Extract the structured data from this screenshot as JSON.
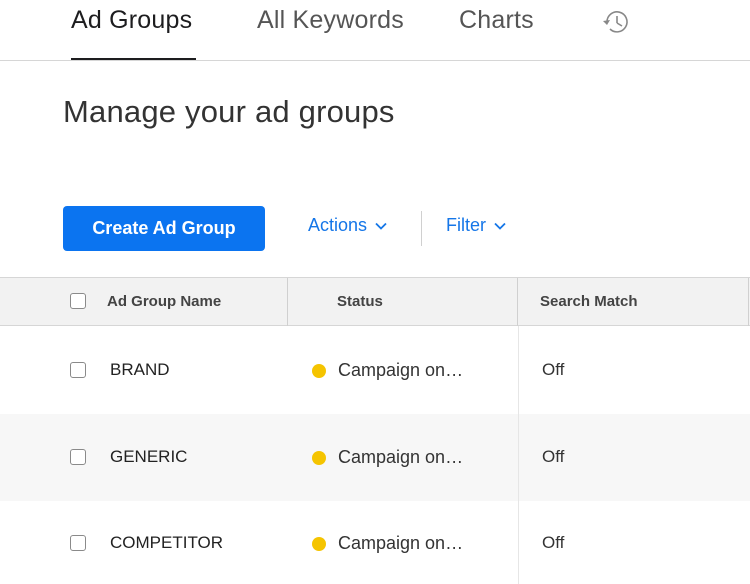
{
  "tabs": [
    {
      "label": "Ad Groups",
      "active": true
    },
    {
      "label": "All Keywords",
      "active": false
    },
    {
      "label": "Charts",
      "active": false
    }
  ],
  "history_icon": "history-clock-icon",
  "page": {
    "title": "Manage your ad groups"
  },
  "toolbar": {
    "create_label": "Create Ad Group",
    "actions_label": "Actions",
    "filter_label": "Filter"
  },
  "table": {
    "columns": [
      "Ad Group Name",
      "Status",
      "Search Match"
    ],
    "rows": [
      {
        "name": "BRAND",
        "status": "Campaign on…",
        "search_match": "Off"
      },
      {
        "name": "GENERIC",
        "status": "Campaign on…",
        "search_match": "Off"
      },
      {
        "name": "COMPETITOR",
        "status": "Campaign on…",
        "search_match": "Off"
      }
    ]
  },
  "colors": {
    "accent": "#0b74f0",
    "link": "#1576e8",
    "status_dot": "#f5c400"
  }
}
